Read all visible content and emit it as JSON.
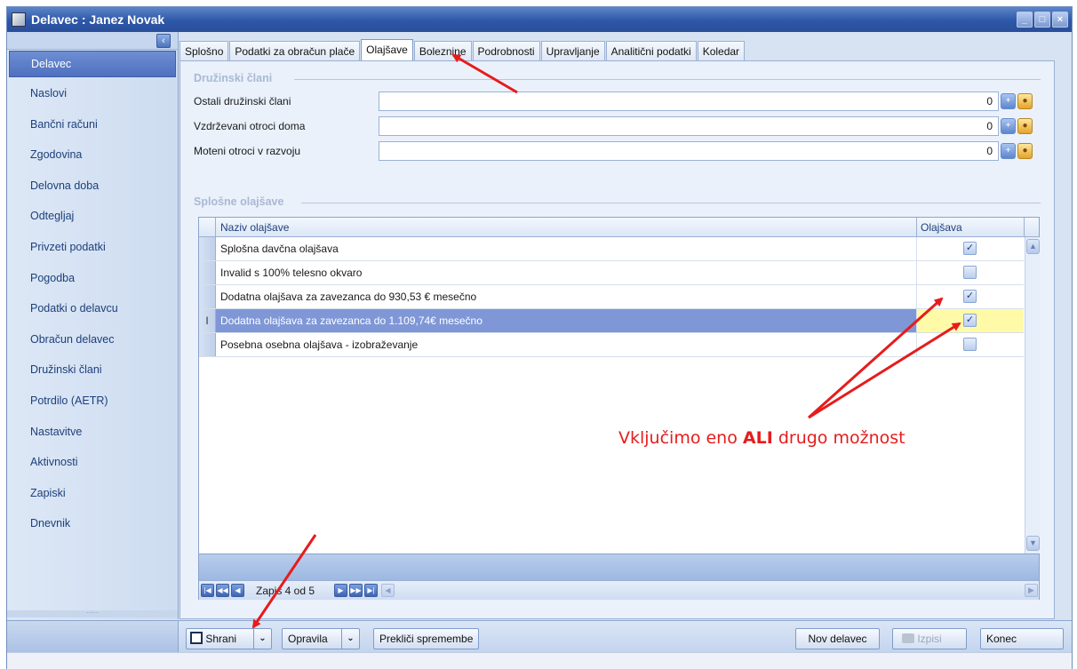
{
  "window": {
    "title": "Delavec : Janez Novak",
    "min": "_",
    "max": "□",
    "close": "×"
  },
  "sidebar": {
    "items": [
      {
        "label": "Delavec",
        "active": true
      },
      {
        "label": "Naslovi"
      },
      {
        "label": "Bančni računi"
      },
      {
        "label": "Zgodovina"
      },
      {
        "label": "Delovna doba"
      },
      {
        "label": "Odtegljaj"
      },
      {
        "label": "Privzeti podatki"
      },
      {
        "label": "Pogodba"
      },
      {
        "label": "Podatki o delavcu"
      },
      {
        "label": "Obračun delavec"
      },
      {
        "label": "Družinski člani"
      },
      {
        "label": "Potrdilo (AETR)"
      },
      {
        "label": "Nastavitve"
      },
      {
        "label": "Aktivnosti"
      },
      {
        "label": "Zapiski"
      },
      {
        "label": "Dnevnik"
      }
    ]
  },
  "tabs": [
    {
      "label": "Splošno"
    },
    {
      "label": "Podatki za obračun plače"
    },
    {
      "label": "Olajšave",
      "active": true
    },
    {
      "label": "Bolezni­ne"
    },
    {
      "label": "Podrobnosti"
    },
    {
      "label": "Upravljanje"
    },
    {
      "label": "Analitični podatki"
    },
    {
      "label": "Koledar"
    }
  ],
  "family": {
    "group_label": "Družinski člani",
    "fields": [
      {
        "label": "Ostali družinski člani",
        "value": "0"
      },
      {
        "label": "Vzdrževani otroci doma",
        "value": "0"
      },
      {
        "label": "Moteni otroci v razvoju",
        "value": "0"
      }
    ]
  },
  "reliefs": {
    "group_label": "Splošne olajšave",
    "col_name": "Naziv olajšave",
    "col_relief": "Olajšava",
    "rows": [
      {
        "name": "Splošna davčna olajšava",
        "checked": true
      },
      {
        "name": "Invalid s 100% telesno okvaro",
        "checked": false
      },
      {
        "name": "Dodatna olajšava za zavezanca do 930,53 € mesečno",
        "checked": true
      },
      {
        "name": "Dodatna olajšava za zavezanca do 1.109,74€ mesečno",
        "checked": true,
        "selected": true
      },
      {
        "name": "Posebna osebna olajšava - izobraževanje",
        "checked": false
      }
    ],
    "selected_indicator": "I",
    "record_text": "Zapis 4 od 5"
  },
  "toolbar": {
    "save": "Shrani",
    "tasks": "Opravila",
    "cancel": "Prekliči spremembe",
    "new_worker": "Nov delavec",
    "print": "Izpisi",
    "end": "Konec"
  },
  "annotation": {
    "before": "Vključimo eno ",
    "bold": "ALI",
    "after": " drugo možnost",
    "color": "#e61c1c"
  },
  "colors": {
    "title_bar": "#2d57a8",
    "selected_row": "#7f97d6",
    "highlight_cell": "#fffaa8",
    "arrow": "#e61c1c"
  }
}
